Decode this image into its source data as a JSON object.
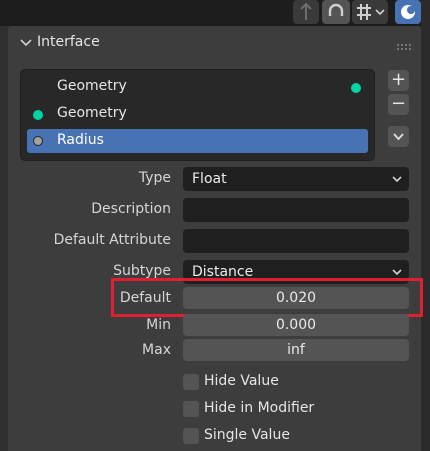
{
  "panel": {
    "title": "Interface"
  },
  "interface_list": {
    "items": [
      {
        "label": "Geometry",
        "socket": "output",
        "socket_color": "#00d6a3"
      },
      {
        "label": "Geometry",
        "socket": "input",
        "socket_color": "#00d6a3"
      },
      {
        "label": "Radius",
        "socket": "input",
        "socket_color": "#a1a1a1",
        "selected": true
      }
    ],
    "add_label": "+",
    "remove_label": "−"
  },
  "properties": {
    "type_label": "Type",
    "type_value": "Float",
    "description_label": "Description",
    "description_value": "",
    "default_attribute_label": "Default Attribute",
    "default_attribute_value": "",
    "subtype_label": "Subtype",
    "subtype_value": "Distance",
    "default_label": "Default",
    "default_value": "0.020",
    "min_label": "Min",
    "min_value": "0.000",
    "max_label": "Max",
    "max_value": "inf"
  },
  "options": {
    "hide_value": "Hide Value",
    "hide_in_modifier": "Hide in Modifier",
    "single_value": "Single Value"
  },
  "colors": {
    "accent": "#4772b3",
    "highlight": "#e02032",
    "geometry_socket": "#00d6a3",
    "float_socket": "#a1a1a1"
  }
}
